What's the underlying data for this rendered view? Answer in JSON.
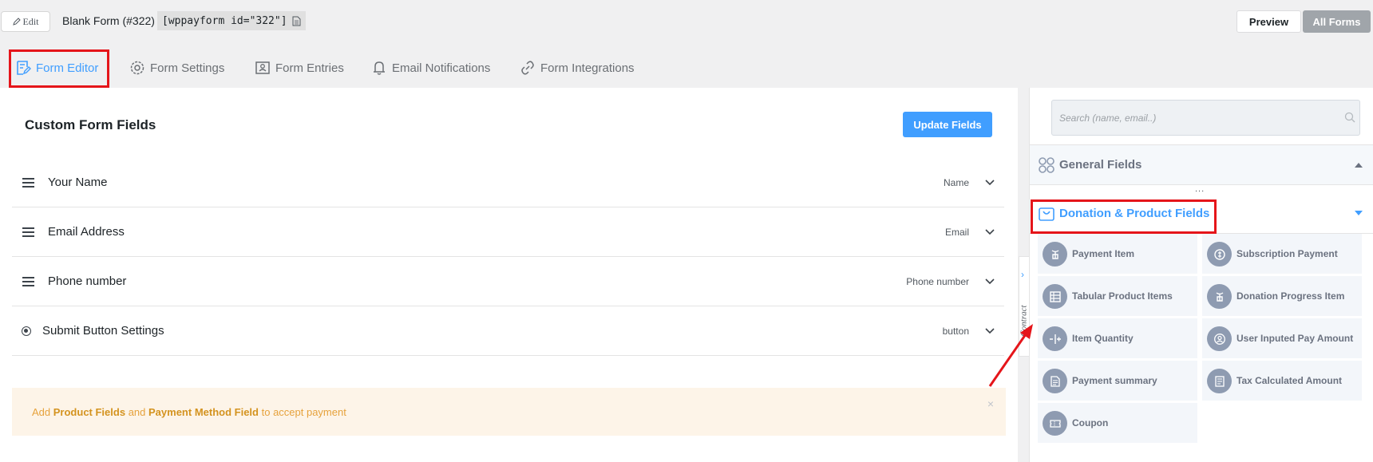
{
  "topbar": {
    "edit_label": "Edit",
    "form_title": "Blank Form (#322)",
    "shortcode": "[wppayform id=\"322\"]",
    "preview_label": "Preview",
    "all_forms_label": "All Forms"
  },
  "tabs": [
    {
      "label": "Form Editor"
    },
    {
      "label": "Form Settings"
    },
    {
      "label": "Form Entries"
    },
    {
      "label": "Email Notifications"
    },
    {
      "label": "Form Integrations"
    }
  ],
  "editor": {
    "title": "Custom Form Fields",
    "update_label": "Update Fields",
    "fields": [
      {
        "label": "Your Name",
        "type": "Name"
      },
      {
        "label": "Email Address",
        "type": "Email"
      },
      {
        "label": "Phone number",
        "type": "Phone number"
      },
      {
        "label": "Submit Button Settings",
        "type": "button"
      }
    ],
    "notice": {
      "pre": "Add ",
      "bold1": "Product Fields",
      "mid": " and ",
      "bold2": "Payment Method Field",
      "post": " to accept payment",
      "close": "×"
    }
  },
  "contract_label": "Contract",
  "sidebar": {
    "search_placeholder": "Search (name, email..)",
    "general_title": "General Fields",
    "dots": "...",
    "donation_title": "Donation & Product Fields",
    "items": [
      {
        "label": "Payment Item",
        "icon": "payment-item-icon"
      },
      {
        "label": "Subscription Payment",
        "icon": "subscription-icon"
      },
      {
        "label": "Tabular Product Items",
        "icon": "table-icon"
      },
      {
        "label": "Donation Progress Item",
        "icon": "donation-icon"
      },
      {
        "label": "Item Quantity",
        "icon": "quantity-icon"
      },
      {
        "label": "User Inputed Pay Amount",
        "icon": "user-amount-icon"
      },
      {
        "label": "Payment summary",
        "icon": "summary-icon"
      },
      {
        "label": "Tax Calculated Amount",
        "icon": "tax-icon"
      },
      {
        "label": "Coupon",
        "icon": "coupon-icon"
      }
    ]
  },
  "colors": {
    "accent": "#409eff",
    "highlight": "#e5151a",
    "notice_bg": "#fdf4e8",
    "notice_text": "#e6a23c"
  }
}
